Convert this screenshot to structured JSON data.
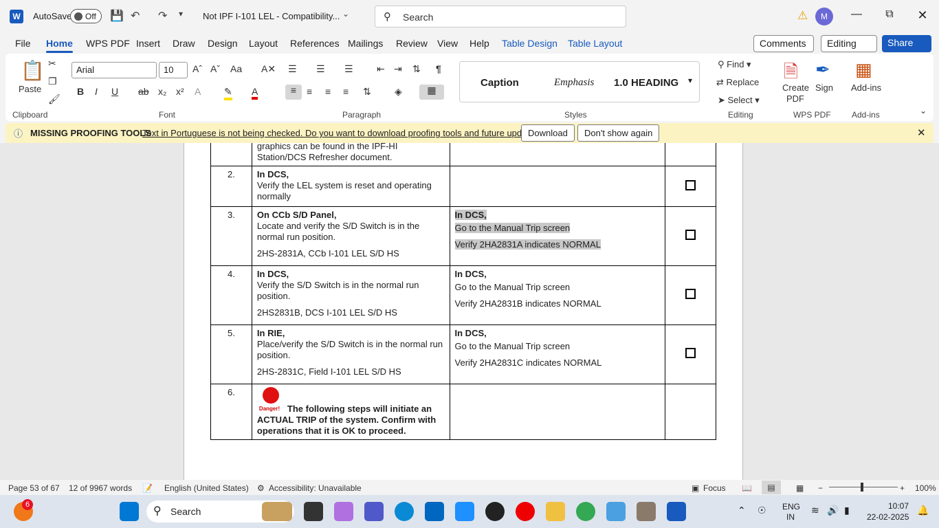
{
  "titlebar": {
    "app_icon": "W",
    "autosave": "AutoSave",
    "toggle": "Off",
    "doc_title": "Not IPF I-101 LEL  -  Compatibility...",
    "search_placeholder": "Search",
    "avatar": "M"
  },
  "tabs": [
    "File",
    "Home",
    "WPS PDF",
    "Insert",
    "Draw",
    "Design",
    "Layout",
    "References",
    "Mailings",
    "Review",
    "View",
    "Help",
    "Table Design",
    "Table Layout"
  ],
  "actions": {
    "comments": "Comments",
    "editing": "Editing",
    "share": "Share"
  },
  "ribbon": {
    "clipboard": {
      "paste": "Paste",
      "label": "Clipboard"
    },
    "font": {
      "name": "Arial",
      "size": "10",
      "label": "Font"
    },
    "paragraph": {
      "label": "Paragraph"
    },
    "styles": {
      "items": [
        "Caption",
        "Emphasis",
        "1.0  HEADING"
      ],
      "label": "Styles"
    },
    "editing": {
      "find": "Find",
      "replace": "Replace",
      "select": "Select",
      "label": "Editing"
    },
    "wps": {
      "create": "Create",
      "pdf": "PDF",
      "sign": "Sign",
      "label": "WPS PDF"
    },
    "addins": {
      "btn": "Add-ins",
      "label": "Add-ins"
    }
  },
  "infobar": {
    "title": "MISSING PROOFING TOOLS",
    "message": "Text in Portuguese is not being checked. Do you want to download proofing tools and future updates?",
    "download": "Download",
    "dont_show": "Don't show again"
  },
  "table": {
    "top_fragment": [
      "graphics can be found in the IPF-HI",
      "Station/DCS Refresher document."
    ],
    "rows": [
      {
        "num": "2.",
        "c2_head": "In DCS,",
        "c2_lines": [
          "Verify the LEL system is reset and operating normally"
        ],
        "c2_tag": "",
        "c3_head": "",
        "c3_lines": [],
        "c3_tag": "",
        "box": true
      },
      {
        "num": "3.",
        "c2_head": "On CCb S/D Panel,",
        "c2_lines": [
          "Locate and verify the S/D Switch is in the normal run position."
        ],
        "c2_tag": "2HS-2831A, CCb I-101 LEL S/D HS",
        "c3_head": "In DCS,",
        "c3_lines": [
          "Go to the Manual Trip screen"
        ],
        "c3_tag": "Verify 2HA2831A indicates NORMAL",
        "box": true
      },
      {
        "num": "4.",
        "c2_head": "In DCS,",
        "c2_lines": [
          "Verify the S/D Switch is in the normal run position."
        ],
        "c2_tag": "2HS2831B, DCS I-101 LEL S/D HS",
        "c3_head": "In DCS,",
        "c3_lines": [
          "Go to the Manual Trip screen"
        ],
        "c3_tag": "Verify 2HA2831B indicates NORMAL",
        "box": true
      },
      {
        "num": "5.",
        "c2_head": "In RIE,",
        "c2_lines": [
          "Place/verify the S/D Switch is in the normal run position."
        ],
        "c2_tag": "2HS-2831C, Field I-101 LEL S/D HS",
        "c3_head": "In DCS,",
        "c3_lines": [
          "Go to the Manual Trip screen"
        ],
        "c3_tag": "Verify 2HA2831C indicates NORMAL",
        "box": true
      }
    ],
    "danger_row": {
      "num": "6.",
      "badge": "Danger!",
      "text": "The following steps will initiate an ACTUAL TRIP of the system. Confirm with operations that it is OK to proceed."
    }
  },
  "status": {
    "page": "Page 53 of 67",
    "words": "12 of 9967 words",
    "language": "English (United States)",
    "accessibility": "Accessibility: Unavailable",
    "focus": "Focus",
    "zoom": "100%"
  },
  "taskbar": {
    "badge": "6",
    "search": "Search",
    "lang1": "ENG",
    "lang2": "IN",
    "time": "10:07",
    "date": "22-02-2025"
  }
}
